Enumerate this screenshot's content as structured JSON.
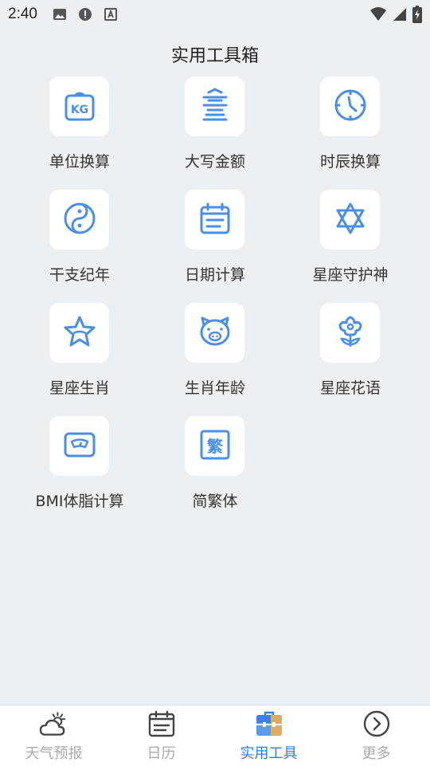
{
  "status_bar": {
    "time": "2:40",
    "left_icons": [
      "image-icon",
      "alert-icon",
      "a-box-icon"
    ],
    "right_icons": [
      "wifi-icon",
      "signal-icon",
      "battery-icon"
    ]
  },
  "page": {
    "title": "实用工具箱",
    "accent": "#4a8fe6"
  },
  "tools": [
    {
      "label": "单位换算",
      "icon": "kg-weight-icon"
    },
    {
      "label": "大写金额",
      "icon": "chinese-numeral-icon"
    },
    {
      "label": "时辰换算",
      "icon": "compass-clock-icon"
    },
    {
      "label": "干支纪年",
      "icon": "yin-yang-icon"
    },
    {
      "label": "日期计算",
      "icon": "calendar-icon"
    },
    {
      "label": "星座守护神",
      "icon": "hexagram-icon"
    },
    {
      "label": "星座生肖",
      "icon": "star-icon"
    },
    {
      "label": "生肖年龄",
      "icon": "pig-icon"
    },
    {
      "label": "星座花语",
      "icon": "flower-icon"
    },
    {
      "label": "BMI体脂计算",
      "icon": "scale-icon"
    },
    {
      "label": "简繁体",
      "icon": "traditional-char-icon",
      "glyph": "繁"
    }
  ],
  "tabs": [
    {
      "label": "天气预报",
      "icon": "weather-icon",
      "active": false
    },
    {
      "label": "日历",
      "icon": "calendar-tab-icon",
      "active": false
    },
    {
      "label": "实用工具",
      "icon": "toolbox-icon",
      "active": true
    },
    {
      "label": "更多",
      "icon": "more-chevron-icon",
      "active": false
    }
  ],
  "colors": {
    "background": "#edf0f3",
    "tile": "#ffffff",
    "icon_blue": "#4a8fe6",
    "tab_active": "#2f7de1",
    "tab_inactive": "#aaaaaa"
  }
}
